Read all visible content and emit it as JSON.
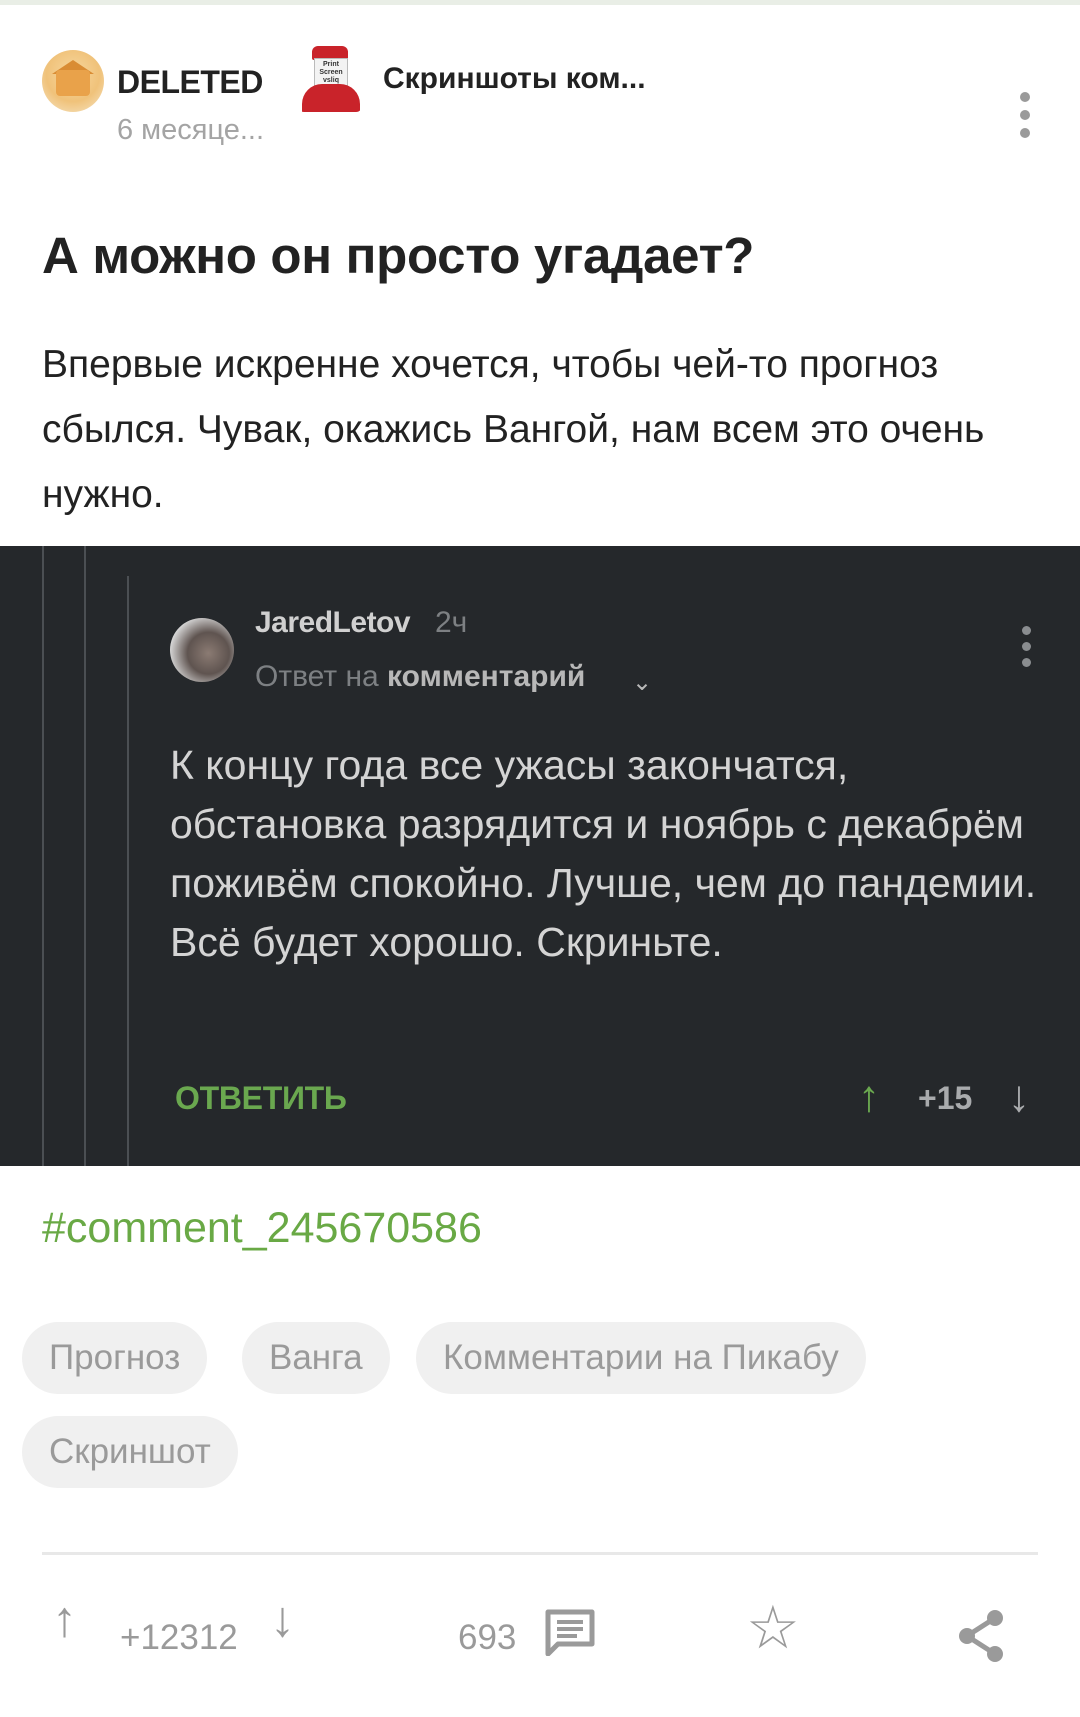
{
  "header": {
    "author": "DELETED",
    "time": "6 месяце...",
    "community": "Скриншоты ком..."
  },
  "post": {
    "title": "А можно он просто угадает?",
    "body": "Впервые искренне хочется, чтобы чей-то прогноз сбылся. Чувак, окажись Вангой, нам всем это очень нужно."
  },
  "comment": {
    "user": "JaredLetov",
    "time": "2ч",
    "reply_prefix": "Ответ на",
    "reply_target": "комментарий",
    "text": "К концу года все ужасы закончатся, обстановка разрядится и ноябрь с декабрём поживём спокойно. Лучше, чем до пандемии. Всё будет хорошо. Скриньте.",
    "reply_button": "ОТВЕТИТЬ",
    "score": "+15"
  },
  "link": "#comment_245670586",
  "tags": [
    "Прогноз",
    "Ванга",
    "Комментарии на Пикабу",
    "Скриншот"
  ],
  "footer": {
    "rating": "+12312",
    "comments": "693"
  },
  "colors": {
    "accent": "#69a945",
    "dark_bg": "#25282b"
  },
  "icons": [
    "author-avatar",
    "community-avatar",
    "more-icon",
    "upvote-icon",
    "downvote-icon",
    "comment-icon",
    "star-icon",
    "share-icon"
  ]
}
